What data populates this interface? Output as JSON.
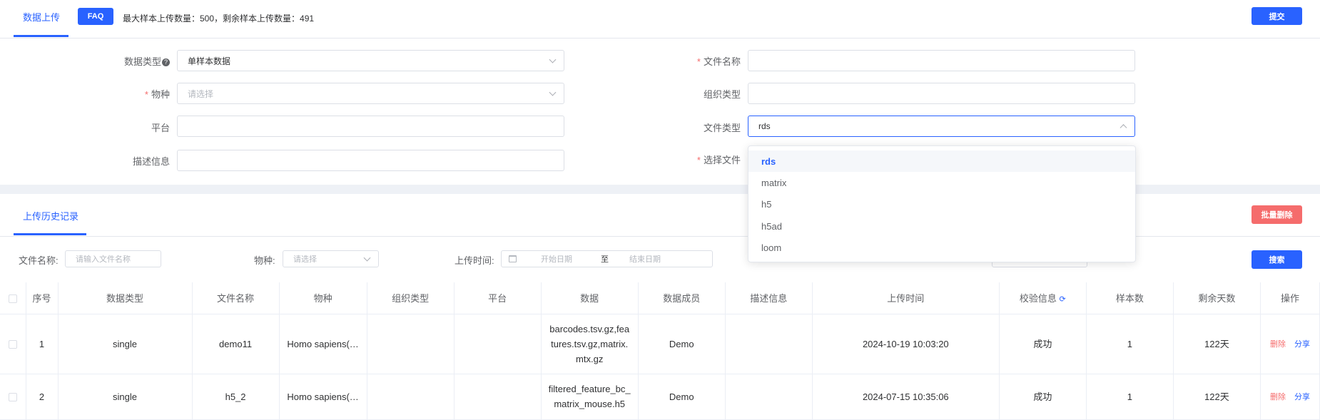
{
  "header": {
    "tab_upload": "数据上传",
    "faq_label": "FAQ",
    "quota_text": "最大样本上传数量：500，剩余样本上传数量：491",
    "submit_label": "提交"
  },
  "form": {
    "data_type": {
      "label": "数据类型",
      "value": "单样本数据"
    },
    "species": {
      "label": "物种",
      "placeholder": "请选择"
    },
    "platform": {
      "label": "平台",
      "value": ""
    },
    "description": {
      "label": "描述信息",
      "value": ""
    },
    "file_name": {
      "label": "文件名称",
      "value": ""
    },
    "tissue_type": {
      "label": "组织类型",
      "value": ""
    },
    "file_type": {
      "label": "文件类型",
      "value": "rds"
    },
    "select_file": {
      "label": "选择文件"
    },
    "file_type_options": [
      "rds",
      "matrix",
      "h5",
      "h5ad",
      "loom"
    ]
  },
  "history": {
    "tab_label": "上传历史记录",
    "batch_delete_label": "批量删除",
    "filters": {
      "file_name_label": "文件名称:",
      "file_name_placeholder": "请输入文件名称",
      "species_label": "物种:",
      "species_placeholder": "请选择",
      "upload_time_label": "上传时间:",
      "start_placeholder": "开始日期",
      "range_sep": "至",
      "end_placeholder": "结束日期",
      "search_label": "搜索"
    },
    "columns": [
      "序号",
      "数据类型",
      "文件名称",
      "物种",
      "组织类型",
      "平台",
      "数据",
      "数据成员",
      "描述信息",
      "上传时间",
      "校验信息",
      "样本数",
      "剩余天数",
      "操作"
    ],
    "rows": [
      {
        "index": "1",
        "data_type": "single",
        "file_name": "demo11",
        "species": "Homo sapiens(…",
        "tissue": "",
        "platform": "",
        "data": "barcodes.tsv.gz,features.tsv.gz,matrix.mtx.gz",
        "member": "Demo",
        "desc": "",
        "time": "2024-10-19 10:03:20",
        "check": "成功",
        "samples": "1",
        "days": "122天",
        "op_delete": "删除",
        "op_share": "分享"
      },
      {
        "index": "2",
        "data_type": "single",
        "file_name": "h5_2",
        "species": "Homo sapiens(…",
        "tissue": "",
        "platform": "",
        "data": "filtered_feature_bc_matrix_mouse.h5",
        "member": "Demo",
        "desc": "",
        "time": "2024-07-15 10:35:06",
        "check": "成功",
        "samples": "1",
        "days": "122天",
        "op_delete": "删除",
        "op_share": "分享"
      }
    ]
  },
  "colors": {
    "primary": "#2962ff",
    "danger": "#f56c6c",
    "border": "#dcdfe6"
  }
}
